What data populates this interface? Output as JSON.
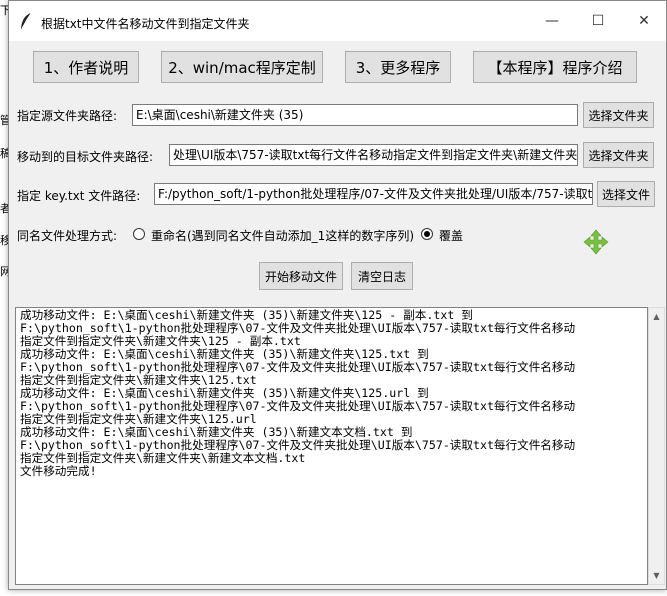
{
  "background": {
    "fragments": [
      "下载",
      "管",
      "稿",
      "者",
      "移",
      "网"
    ]
  },
  "window": {
    "title": "根据txt中文件名移动文件到指定文件夹",
    "minimize_glyph": "—",
    "maximize_glyph": "☐",
    "close_glyph": "✕"
  },
  "toolbar": {
    "author_label": "1、作者说明",
    "custom_label": "2、win/mac程序定制",
    "more_label": "3、更多程序",
    "intro_label": "【本程序】程序介绍"
  },
  "form": {
    "source_label": "指定源文件夹路径:",
    "source_value": "E:\\桌面\\ceshi\\新建文件夹 (35)",
    "target_label": "移动到的目标文件夹路径:",
    "target_value": "处理\\UI版本\\757-读取txt每行文件名移动指定文件到指定文件夹\\新建文件夹",
    "key_label": "指定 key.txt 文件路径:",
    "key_value": "F:/python_soft/1-python批处理程序/07-文件及文件夹批处理/UI版本/757-读取t",
    "choose_folder_label": "选择文件夹",
    "choose_file_label": "选择文件",
    "dup_label": "同名文件处理方式:",
    "rename_option": "重命名(遇到同名文件自动添加_1这样的数字序列)",
    "overwrite_option": "覆盖",
    "selected_option": "overwrite"
  },
  "actions": {
    "start_label": "开始移动文件",
    "clear_label": "清空日志"
  },
  "log": {
    "lines": [
      "成功移动文件: E:\\桌面\\ceshi\\新建文件夹 (35)\\新建文件夹\\125 - 副本.txt 到",
      "F:\\python_soft\\1-python批处理程序\\07-文件及文件夹批处理\\UI版本\\757-读取txt每行文件名移动",
      "指定文件到指定文件夹\\新建文件夹\\125 - 副本.txt",
      "成功移动文件: E:\\桌面\\ceshi\\新建文件夹 (35)\\新建文件夹\\125.txt 到",
      "F:\\python_soft\\1-python批处理程序\\07-文件及文件夹批处理\\UI版本\\757-读取txt每行文件名移动",
      "指定文件到指定文件夹\\新建文件夹\\125.txt",
      "成功移动文件: E:\\桌面\\ceshi\\新建文件夹 (35)\\新建文件夹\\125.url 到",
      "F:\\python_soft\\1-python批处理程序\\07-文件及文件夹批处理\\UI版本\\757-读取txt每行文件名移动",
      "指定文件到指定文件夹\\新建文件夹\\125.url",
      "成功移动文件: E:\\桌面\\ceshi\\新建文件夹 (35)\\新建文本文档.txt 到",
      "F:\\python_soft\\1-python批处理程序\\07-文件及文件夹批处理\\UI版本\\757-读取txt每行文件名移动",
      "指定文件到指定文件夹\\新建文件夹\\新建文本文档.txt",
      "文件移动完成!"
    ]
  },
  "icons": {
    "app": "feather-icon",
    "move": "move-arrows-icon",
    "move_color": "#7ac142"
  }
}
